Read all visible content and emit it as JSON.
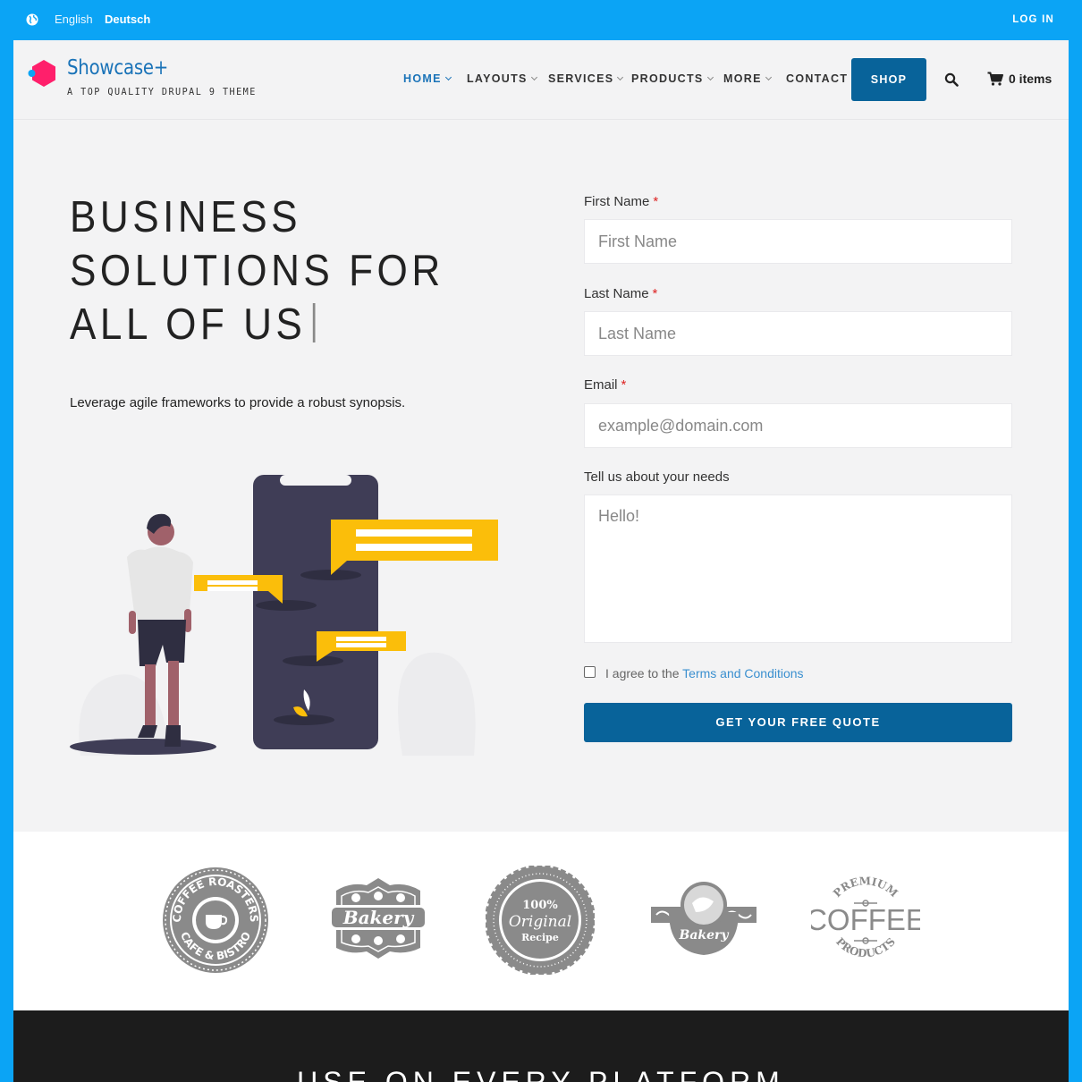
{
  "topbar": {
    "languages": [
      "English",
      "Deutsch"
    ],
    "login_label": "LOG IN"
  },
  "header": {
    "site_name": "Showcase+",
    "slogan": "A TOP QUALITY DRUPAL 9 THEME",
    "nav": [
      {
        "label": "HOME",
        "active": true,
        "has_dropdown": true
      },
      {
        "label": "LAYOUTS",
        "active": false,
        "has_dropdown": true
      },
      {
        "label": "SERVICES",
        "active": false,
        "has_dropdown": true
      },
      {
        "label": "PRODUCTS",
        "active": false,
        "has_dropdown": true
      },
      {
        "label": "MORE",
        "active": false,
        "has_dropdown": true
      },
      {
        "label": "CONTACT",
        "active": false,
        "has_dropdown": false
      }
    ],
    "shop_label": "SHOP",
    "cart_label": "0 items"
  },
  "hero": {
    "title_lines": [
      "BUSINESS",
      "SOLUTIONS FOR",
      "ALL OF US"
    ],
    "subtitle": "Leverage agile frameworks to provide a robust synopsis."
  },
  "form": {
    "first_name_label": "First Name",
    "first_name_placeholder": "First Name",
    "last_name_label": "Last Name",
    "last_name_placeholder": "Last Name",
    "email_label": "Email",
    "email_placeholder": "example@domain.com",
    "needs_label": "Tell us about your needs",
    "needs_placeholder": "Hello!",
    "required_mark": "*",
    "agree_prefix": "I agree to the",
    "terms_link": "Terms and Conditions",
    "submit_label": "GET YOUR FREE QUOTE"
  },
  "logos": [
    {
      "name": "coffee-roasters-badge",
      "top": "COFFEE ROASTERS",
      "bottom": "CAFE & BISTRO"
    },
    {
      "name": "bakery-badge",
      "text": "Bakery"
    },
    {
      "name": "original-recipe-badge",
      "top": "100%",
      "middle": "Original",
      "bottom": "Recipe"
    },
    {
      "name": "bakery-banner-badge",
      "text": "Bakery"
    },
    {
      "name": "premium-coffee-badge",
      "top": "PREMIUM",
      "middle": "COFFEE",
      "bottom": "PRODUCTS"
    }
  ],
  "platform_section": {
    "title": "USE ON EVERY PLATFORM"
  },
  "colors": {
    "accent": "#0ba4f5",
    "primary": "#08639a",
    "brand": "#1a73b8",
    "logo": "#ff1f6b",
    "illustration_phone": "#3f3d56",
    "illustration_bubble": "#fbbe0a"
  }
}
